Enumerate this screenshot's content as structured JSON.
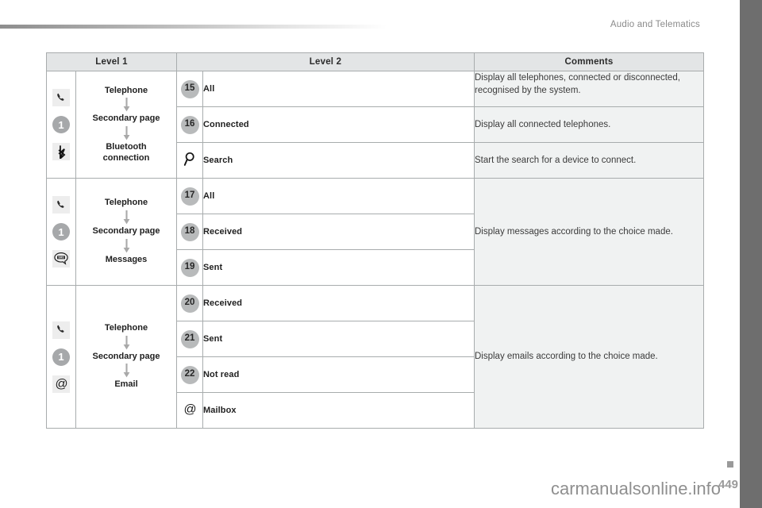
{
  "header": {
    "title": "Audio and Telematics"
  },
  "table": {
    "columns": [
      "Level 1",
      "Level 2",
      "Comments"
    ],
    "sections": [
      {
        "icons": [
          "phone-handset-icon",
          "badge-1-icon",
          "bluetooth-icon"
        ],
        "icon_badge_label": "1",
        "icon_sms_label": "",
        "flow": [
          "Telephone",
          "Secondary page",
          "Bluetooth connection"
        ],
        "flow_lines": [
          [
            "Telephone"
          ],
          [
            "Secondary page"
          ],
          [
            "Bluetooth",
            "connection"
          ]
        ],
        "rows": [
          {
            "badge": "15",
            "badge_icon": "",
            "label": "All",
            "comment": "Display all telephones, connected or disconnected, recognised by the system."
          },
          {
            "badge": "16",
            "badge_icon": "",
            "label": "Connected",
            "comment": "Display all connected telephones."
          },
          {
            "badge": "",
            "badge_icon": "search-icon",
            "label": "Search",
            "comment": "Start the search for a device to connect."
          }
        ],
        "shared_comment": ""
      },
      {
        "icons": [
          "phone-handset-icon",
          "badge-1-icon",
          "sms-bubble-icon"
        ],
        "icon_badge_label": "1",
        "icon_sms_label": "SMS",
        "flow": [
          "Telephone",
          "Secondary page",
          "Messages"
        ],
        "flow_lines": [
          [
            "Telephone"
          ],
          [
            "Secondary page"
          ],
          [
            "Messages"
          ]
        ],
        "rows": [
          {
            "badge": "17",
            "badge_icon": "",
            "label": "All",
            "comment": ""
          },
          {
            "badge": "18",
            "badge_icon": "",
            "label": "Received",
            "comment": ""
          },
          {
            "badge": "19",
            "badge_icon": "",
            "label": "Sent",
            "comment": ""
          }
        ],
        "shared_comment": "Display messages according to the choice made."
      },
      {
        "icons": [
          "phone-handset-icon",
          "badge-1-icon",
          "at-sign-icon"
        ],
        "icon_badge_label": "1",
        "icon_sms_label": "",
        "flow": [
          "Telephone",
          "Secondary page",
          "Email"
        ],
        "flow_lines": [
          [
            "Telephone"
          ],
          [
            "Secondary page"
          ],
          [
            "Email"
          ]
        ],
        "rows": [
          {
            "badge": "20",
            "badge_icon": "",
            "label": "Received",
            "comment": ""
          },
          {
            "badge": "21",
            "badge_icon": "",
            "label": "Sent",
            "comment": ""
          },
          {
            "badge": "22",
            "badge_icon": "",
            "label": "Not read",
            "comment": ""
          },
          {
            "badge": "",
            "badge_icon": "at-sign-icon",
            "label": "Mailbox",
            "comment": ""
          }
        ],
        "shared_comment": "Display emails according to the choice made."
      }
    ]
  },
  "footer": {
    "watermark": "carmanualsonline.info",
    "page_number": "449"
  },
  "colors": {
    "header_fill": "#e3e5e6",
    "comment_fill": "#f0f2f2",
    "border": "#a8acad",
    "badge_fill": "#b8babb",
    "icon_box_fill": "#ededed",
    "edge_bar": "#6e6e6e"
  }
}
